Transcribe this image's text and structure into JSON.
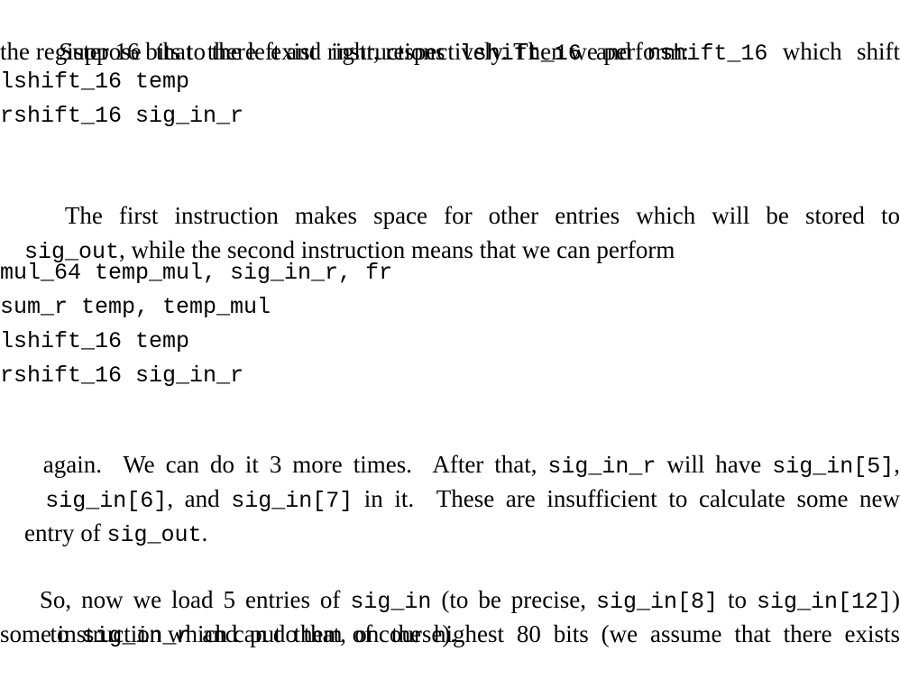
{
  "paragraph1": {
    "line1": {
      "a": "Suppose that there exist instructions ",
      "b": "lshift_16",
      "c": " and ",
      "d": "rshift_16",
      "e": " which shift"
    },
    "line2": "the register 16 bits to the left and right, respectively. Then we perform:"
  },
  "code1": [
    "lshift_16 temp",
    "rshift_16 sig_in_r"
  ],
  "paragraph2": {
    "line1": {
      "a": "The first instruction makes space for other entries which will be stored to"
    },
    "line2": {
      "a": "sig_out",
      "b": ", while the second instruction means that we can perform"
    }
  },
  "code2": [
    "mul_64 temp_mul, sig_in_r, fr",
    "sum_r temp, temp_mul",
    "lshift_16 temp",
    "rshift_16 sig_in_r"
  ],
  "paragraph3": {
    "line1": {
      "a": "again.  We can do it 3 more times.  After that, ",
      "b": "sig_in_r",
      "c": " will have ",
      "d": "sig_in[5]",
      "e": ","
    },
    "line2": {
      "a": "sig_in[6]",
      "b": ", and ",
      "c": "sig_in[7]",
      "d": " in it.  These are insufficient to calculate some new"
    },
    "line3": {
      "a": "entry of ",
      "b": "sig_out",
      "c": "."
    }
  },
  "paragraph4": {
    "line1": {
      "a": "So, now we load 5 entries of ",
      "b": "sig_in",
      "c": " (to be precise, ",
      "d": "sig_in[8]",
      "e": " to ",
      "f": "sig_in[12]",
      "g": ")"
    },
    "line2": {
      "a": "to ",
      "b": "sig_in_r",
      "c": " and put them on the highest 80 bits (we assume that there exists"
    },
    "line3": "some instruction which can do that, of course)."
  }
}
